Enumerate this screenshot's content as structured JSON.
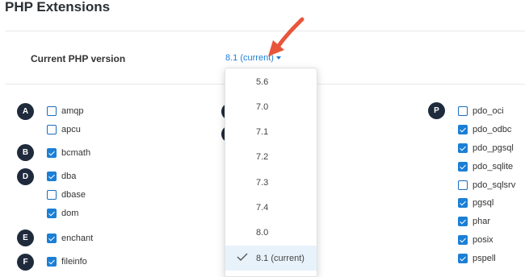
{
  "title": "PHP Extensions",
  "version": {
    "label": "Current PHP version",
    "toggle": "8.1 (current)"
  },
  "dropdown": {
    "options": [
      "5.6",
      "7.0",
      "7.1",
      "7.2",
      "7.3",
      "7.4",
      "8.0",
      "8.1 (current)"
    ],
    "selected": "8.1 (current)"
  },
  "letters": {
    "a": "A",
    "b": "B",
    "d": "D",
    "e": "E",
    "f": "F",
    "p": "P"
  },
  "extensions_left": [
    {
      "name": "amqp",
      "checked": false
    },
    {
      "name": "apcu",
      "checked": false
    },
    {
      "name": "bcmath",
      "checked": true
    },
    {
      "name": "dba",
      "checked": true
    },
    {
      "name": "dbase",
      "checked": false
    },
    {
      "name": "dom",
      "checked": true
    },
    {
      "name": "enchant",
      "checked": true
    },
    {
      "name": "fileinfo",
      "checked": true
    }
  ],
  "extensions_right": [
    {
      "name": "pdo_oci",
      "checked": false
    },
    {
      "name": "pdo_odbc",
      "checked": true
    },
    {
      "name": "pdo_pgsql",
      "checked": true
    },
    {
      "name": "pdo_sqlite",
      "checked": true
    },
    {
      "name": "pdo_sqlsrv",
      "checked": false
    },
    {
      "name": "pgsql",
      "checked": true
    },
    {
      "name": "phar",
      "checked": true
    },
    {
      "name": "posix",
      "checked": true
    },
    {
      "name": "pspell",
      "checked": true
    }
  ],
  "colors": {
    "accent": "#1b7fd6",
    "circle": "#1f2b3c",
    "arrow": "#e8553a"
  }
}
